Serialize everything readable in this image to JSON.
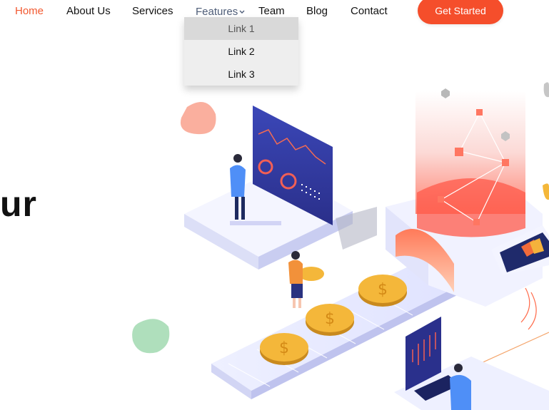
{
  "nav": {
    "home": "Home",
    "about": "About Us",
    "services": "Services",
    "features": "Features",
    "team": "Team",
    "blog": "Blog",
    "contact": "Contact",
    "cta": "Get Started"
  },
  "dropdown": {
    "items": [
      "Link 1",
      "Link 2",
      "Link 3"
    ]
  },
  "hero": {
    "heading_fragment": "ur"
  },
  "colors": {
    "accent": "#f54e2b",
    "active_nav": "#f2582f",
    "features_nav": "#4e5d78",
    "dropdown_bg": "#eeeeee",
    "dropdown_highlight": "#d9d9d9"
  },
  "icons": {
    "features_caret": "chevron-down-icon"
  }
}
